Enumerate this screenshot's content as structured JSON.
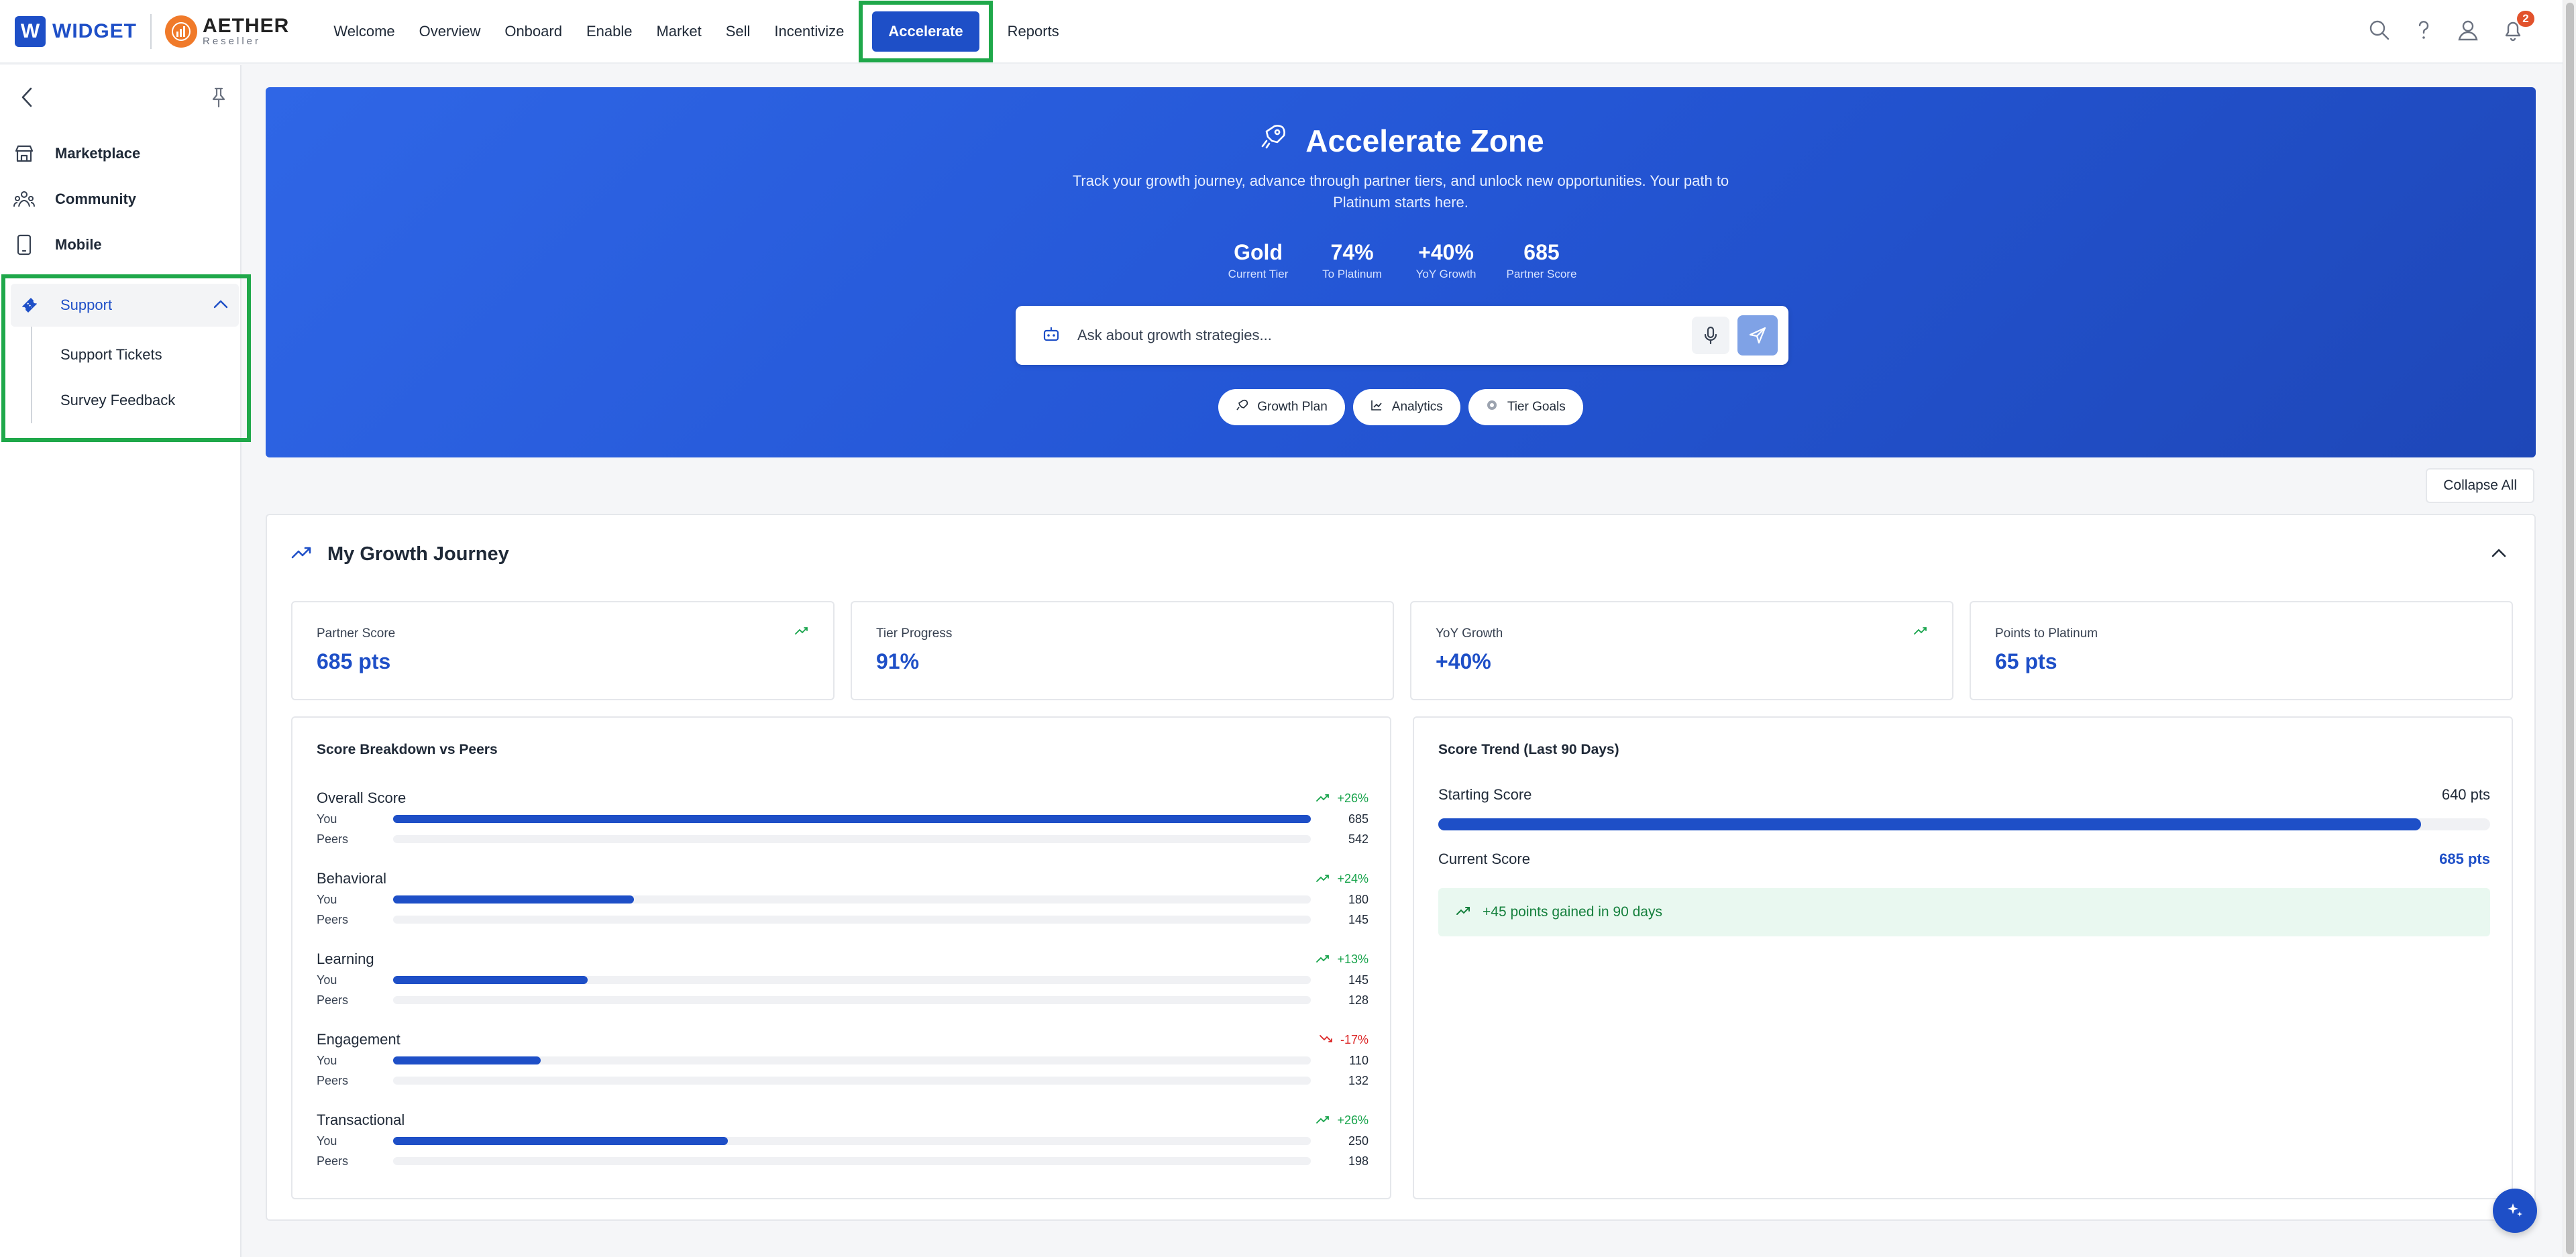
{
  "brand": {
    "widget": "WIDGET",
    "widget_letter": "W",
    "aether": "AETHER",
    "aether_sub": "Reseller"
  },
  "nav": [
    "Welcome",
    "Overview",
    "Onboard",
    "Enable",
    "Market",
    "Sell",
    "Incentivize",
    "Accelerate",
    "Reports"
  ],
  "notifications_count": "2",
  "sidebar": {
    "items": [
      {
        "label": "Marketplace",
        "icon": "store-icon"
      },
      {
        "label": "Community",
        "icon": "community-icon"
      },
      {
        "label": "Mobile",
        "icon": "mobile-icon"
      }
    ],
    "support": {
      "label": "Support",
      "sub": [
        "Support Tickets",
        "Survey Feedback"
      ]
    }
  },
  "hero": {
    "title": "Accelerate Zone",
    "description": "Track your growth journey, advance through partner tiers, and unlock new opportunities. Your path to Platinum starts here.",
    "stats": [
      {
        "value": "Gold",
        "label": "Current Tier"
      },
      {
        "value": "74%",
        "label": "To Platinum"
      },
      {
        "value": "+40%",
        "label": "YoY Growth"
      },
      {
        "value": "685",
        "label": "Partner Score"
      }
    ],
    "search_placeholder": "Ask about growth strategies...",
    "chips": [
      "Growth Plan",
      "Analytics",
      "Tier Goals"
    ]
  },
  "collapse_all": "Collapse All",
  "section": {
    "title": "My Growth Journey",
    "kpis": [
      {
        "label": "Partner Score",
        "value": "685 pts",
        "trend": true
      },
      {
        "label": "Tier Progress",
        "value": "91%",
        "trend": false
      },
      {
        "label": "YoY Growth",
        "value": "+40%",
        "trend": true
      },
      {
        "label": "Points to Platinum",
        "value": "65 pts",
        "trend": false
      }
    ],
    "breakdown": {
      "title": "Score Breakdown vs Peers",
      "you_label": "You",
      "peers_label": "Peers",
      "max": 685,
      "categories": [
        {
          "name": "Overall Score",
          "pct": "+26%",
          "up": true,
          "you": 685,
          "peers": 542
        },
        {
          "name": "Behavioral",
          "pct": "+24%",
          "up": true,
          "you": 180,
          "peers": 145
        },
        {
          "name": "Learning",
          "pct": "+13%",
          "up": true,
          "you": 145,
          "peers": 128
        },
        {
          "name": "Engagement",
          "pct": "-17%",
          "up": false,
          "you": 110,
          "peers": 132
        },
        {
          "name": "Transactional",
          "pct": "+26%",
          "up": true,
          "you": 250,
          "peers": 198
        }
      ]
    },
    "trend": {
      "title": "Score Trend (Last 90 Days)",
      "starting_label": "Starting Score",
      "starting_value": "640 pts",
      "current_label": "Current Score",
      "current_value": "685 pts",
      "progress_fraction": 0.934,
      "gain_text": "+45 points gained in 90 days"
    }
  },
  "colors": {
    "accent": "#1e4fc7",
    "positive": "#16a34a",
    "negative": "#dc2626",
    "highlight": "#1fa84a"
  }
}
